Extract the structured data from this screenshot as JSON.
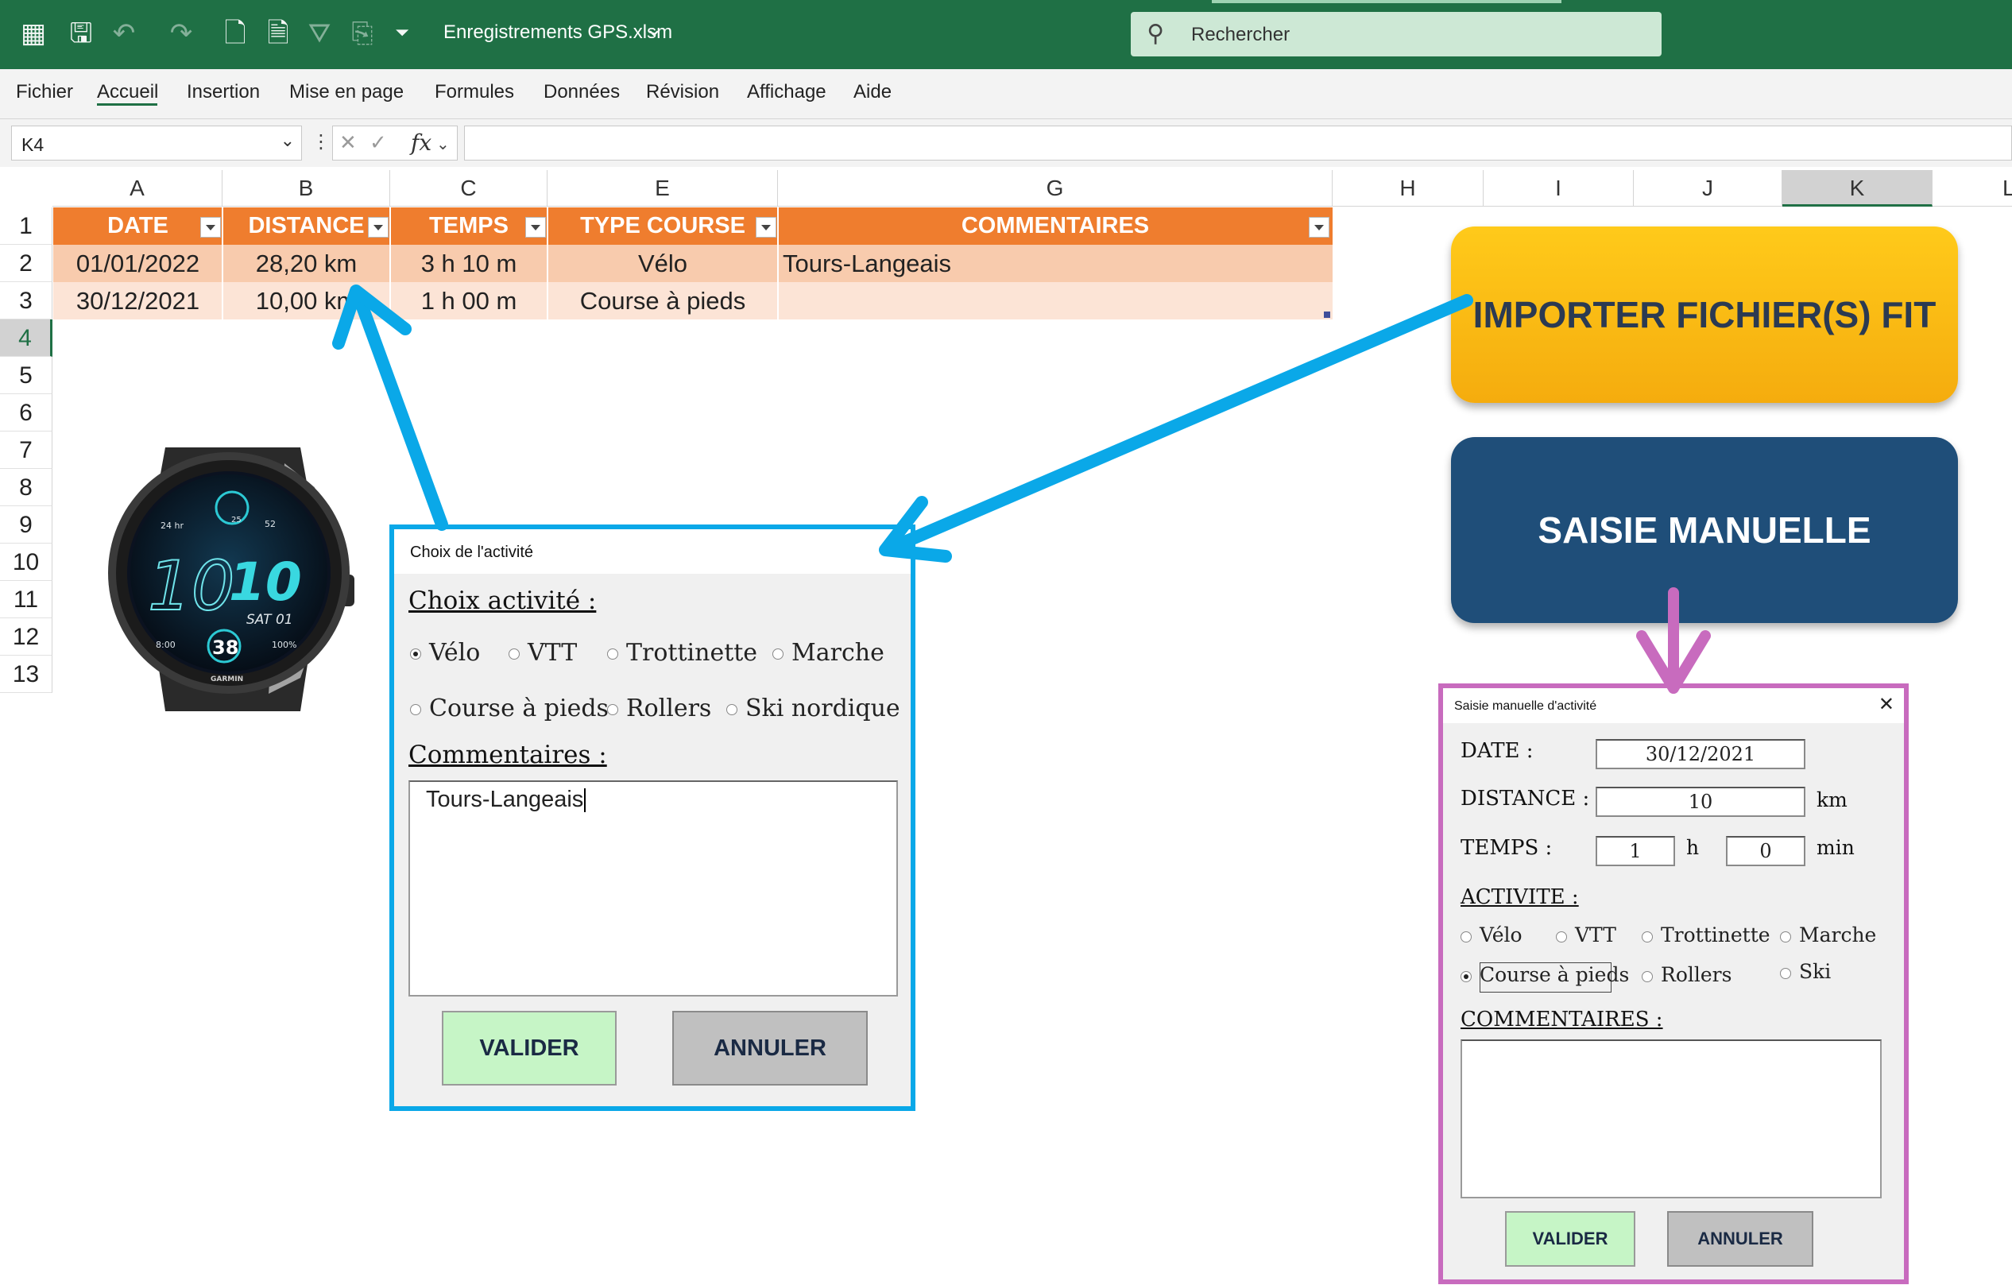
{
  "app": {
    "file_title": "Enregistrements GPS.xlsm",
    "search_placeholder": "Rechercher",
    "qat_icons": [
      "excel-logo-icon",
      "save-icon",
      "undo-icon",
      "redo-icon",
      "new-file-icon",
      "print-preview-icon",
      "clear-filter-icon",
      "export-icon",
      "customize-qat-icon"
    ]
  },
  "menu": [
    "Fichier",
    "Accueil",
    "Insertion",
    "Mise en page",
    "Formules",
    "Données",
    "Révision",
    "Affichage",
    "Aide"
  ],
  "menu_active": "Accueil",
  "formula_bar": {
    "name_box": "K4",
    "formula": ""
  },
  "grid": {
    "columns": [
      "A",
      "B",
      "C",
      "E",
      "G",
      "H",
      "I",
      "J",
      "K",
      "L"
    ],
    "selected_column": "K",
    "rows": [
      "1",
      "2",
      "3",
      "4",
      "5",
      "6",
      "7",
      "8",
      "9",
      "10",
      "11",
      "12",
      "13"
    ],
    "selected_row": "4"
  },
  "table": {
    "headers": [
      "DATE",
      "DISTANCE",
      "TEMPS",
      "TYPE COURSE",
      "COMMENTAIRES"
    ],
    "rows": [
      [
        "01/01/2022",
        "28,20 km",
        "3 h 10 m",
        "Vélo",
        "Tours-Langeais"
      ],
      [
        "30/12/2021",
        "10,00 km",
        "1 h 00 m",
        "Course à pieds",
        ""
      ]
    ]
  },
  "buttons": {
    "import": "IMPORTER FICHIER(S) FIT",
    "manual": "SAISIE MANUELLE"
  },
  "watch": {
    "time_hours": "10",
    "time_minutes": "10",
    "date": "SAT 01",
    "value": "38",
    "brand": "GARMIN",
    "left_complication": "24 hr",
    "steps": "25",
    "vo2": "52",
    "small_time": "8:00",
    "battery": "100%"
  },
  "dialog_activity": {
    "title": "Choix de l'activité",
    "heading_choice": "Choix activité :",
    "options": [
      "Vélo",
      "VTT",
      "Trottinette",
      "Marche",
      "Course à pieds",
      "Rollers",
      "Ski nordique"
    ],
    "selected": "Vélo",
    "heading_comments": "Commentaires :",
    "comment_value": "Tours-Langeais",
    "ok": "VALIDER",
    "cancel": "ANNULER"
  },
  "dialog_manual": {
    "title": "Saisie manuelle d'activité",
    "close": "✕",
    "date_label": "DATE :",
    "date_value": "30/12/2021",
    "distance_label": "DISTANCE :",
    "distance_value": "10",
    "distance_unit": "km",
    "time_label": "TEMPS :",
    "hours_value": "1",
    "hours_unit": "h",
    "minutes_value": "0",
    "minutes_unit": "min",
    "activity_label": "ACTIVITE :",
    "options": [
      "Vélo",
      "VTT",
      "Trottinette",
      "Marche",
      "Course à pieds",
      "Rollers",
      "Ski"
    ],
    "selected": "Course à pieds",
    "comments_label": "COMMENTAIRES :",
    "comment_value": "",
    "ok": "VALIDER",
    "cancel": "ANNULER"
  },
  "colors": {
    "excel_green": "#1f7045",
    "table_header": "#ef7d2e",
    "row_band_1": "#f8cbad",
    "row_band_2": "#fce4d6",
    "import_button": "#f5ac0e",
    "manual_button": "#1f4e79",
    "arrow_blue": "#0aa8e8",
    "arrow_pink": "#c86bbe"
  }
}
